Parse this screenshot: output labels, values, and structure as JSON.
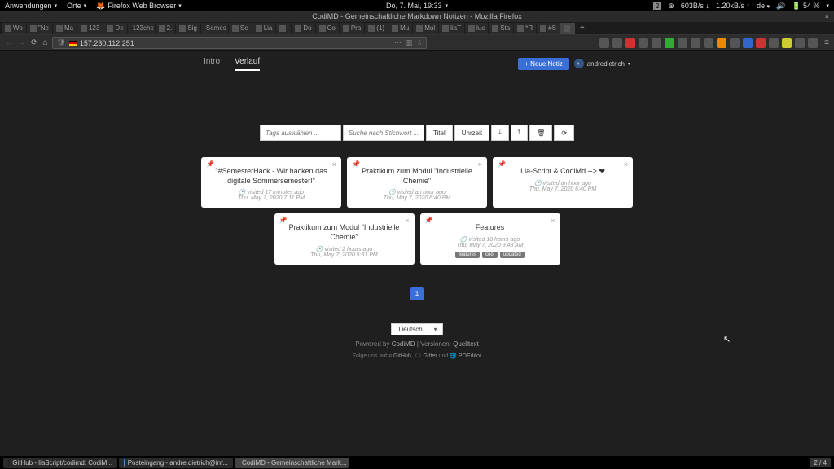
{
  "gnome": {
    "apps": "Anwendungen",
    "places": "Orte",
    "firefox": "Firefox Web Browser",
    "datetime": "Do,  7. Mai, 19:33",
    "net_down": "603B/s",
    "net_up": "1.20kB/s",
    "lang": "de",
    "battery": "54 %",
    "workspace_badge": "2"
  },
  "window": {
    "title": "CodiMD - Gemeinschaftliche Markdown Notizen - Mozilla Firefox"
  },
  "tabs": [
    {
      "label": "Wo"
    },
    {
      "label": "\"Ne"
    },
    {
      "label": "Ma"
    },
    {
      "label": "123"
    },
    {
      "label": "De"
    },
    {
      "label": "123che"
    },
    {
      "label": "2."
    },
    {
      "label": "Sig"
    },
    {
      "label": "Semes"
    },
    {
      "label": "Se"
    },
    {
      "label": "Lia"
    },
    {
      "label": ""
    },
    {
      "label": "Do"
    },
    {
      "label": "Co"
    },
    {
      "label": "Pra"
    },
    {
      "label": "(1)"
    },
    {
      "label": "Mu"
    },
    {
      "label": "Mul"
    },
    {
      "label": "liaT"
    },
    {
      "label": "luc"
    },
    {
      "label": "Sta"
    },
    {
      "label": "*R"
    },
    {
      "label": "#S"
    },
    {
      "label": "",
      "active": true
    }
  ],
  "url": "157.230.112.251",
  "nav": {
    "intro": "Intro",
    "verlauf": "Verlauf",
    "new_note": "+ Neue Notiz",
    "user": "andredietrich"
  },
  "controls": {
    "tags_placeholder": "Tags auswählen ...",
    "search_placeholder": "Suche nach Stichwort ...",
    "title": "Titel",
    "time": "Uhrzeit"
  },
  "cards": [
    {
      "title": "\"#SemesterHack - Wir hacken das digitale Sommersemester!\"",
      "visited": "visited 17 minutes ago",
      "date": "Thu, May 7, 2020 7:11 PM"
    },
    {
      "title": "Praktikum zum Modul \"Industrielle Chemie\"",
      "visited": "visited an hour ago",
      "date": "Thu, May 7, 2020 6:40 PM"
    },
    {
      "title": "Lia-Script & CodiMd --> ❤",
      "visited": "visited an hour ago",
      "date": "Thu, May 7, 2020 6:40 PM",
      "short": true
    },
    {
      "title": "Praktikum zum Modul \"Industrielle Chemie\"",
      "visited": "visited 2 hours ago",
      "date": "Thu, May 7, 2020 5:31 PM"
    },
    {
      "title": "Features",
      "visited": "visited 10 hours ago",
      "date": "Thu, May 7, 2020 9:43 AM",
      "tags": [
        "features",
        "cool",
        "updated"
      ]
    }
  ],
  "pagination": {
    "page": "1"
  },
  "footer": {
    "lang": "Deutsch",
    "powered_prefix": "Powered by ",
    "codimd": "CodiMD",
    "sep": " | ",
    "versions": "Versionen: ",
    "quelltext": "Quelltext",
    "follow_prefix": "Folge uns auf ",
    "github": "GitHub",
    "gitter": "Gitter",
    "und": " und ",
    "poeditor": "POEditor"
  },
  "taskbar": {
    "items": [
      {
        "label": "GitHub - liaScript/codimd: CodiM..."
      },
      {
        "label": "Posteingang - andre.dietrich@inf..."
      },
      {
        "label": "CodiMD - Gemeinschaftliche Mark...",
        "active": true
      }
    ],
    "ws": "2 / 4"
  }
}
